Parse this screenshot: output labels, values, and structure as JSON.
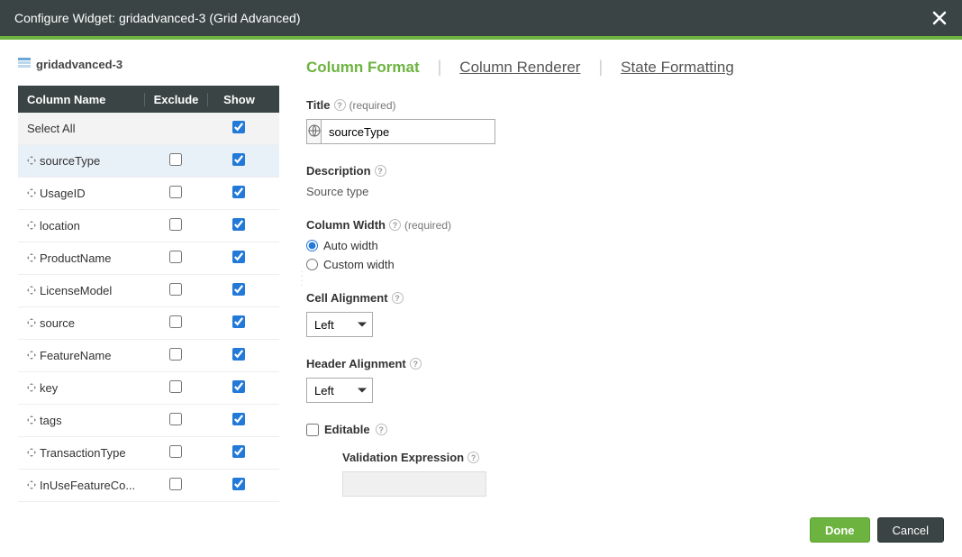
{
  "titlebar": "Configure Widget: gridadvanced-3 (Grid Advanced)",
  "widget_name": "gridadvanced-3",
  "cols_header": {
    "name": "Column Name",
    "exclude": "Exclude",
    "show": "Show"
  },
  "select_all_label": "Select All",
  "rows": [
    {
      "name": "sourceType",
      "exclude": false,
      "show": true,
      "selected": true
    },
    {
      "name": "UsageID",
      "exclude": false,
      "show": true
    },
    {
      "name": "location",
      "exclude": false,
      "show": true
    },
    {
      "name": "ProductName",
      "exclude": false,
      "show": true
    },
    {
      "name": "LicenseModel",
      "exclude": false,
      "show": true
    },
    {
      "name": "source",
      "exclude": false,
      "show": true
    },
    {
      "name": "FeatureName",
      "exclude": false,
      "show": true
    },
    {
      "name": "key",
      "exclude": false,
      "show": true
    },
    {
      "name": "tags",
      "exclude": false,
      "show": true
    },
    {
      "name": "TransactionType",
      "exclude": false,
      "show": true
    },
    {
      "name": "InUseFeatureCo...",
      "exclude": false,
      "show": true
    }
  ],
  "tabs": {
    "format": "Column Format",
    "renderer": "Column Renderer",
    "state": "State Formatting"
  },
  "form": {
    "title_label": "Title",
    "required": "(required)",
    "title_value": "sourceType",
    "desc_label": "Description",
    "desc_value": "Source type",
    "width_label": "Column Width",
    "width_auto": "Auto width",
    "width_custom": "Custom width",
    "cell_align_label": "Cell Alignment",
    "cell_align_value": "Left",
    "header_align_label": "Header Alignment",
    "header_align_value": "Left",
    "editable_label": "Editable",
    "validation_label": "Validation Expression"
  },
  "footer": {
    "done": "Done",
    "cancel": "Cancel"
  }
}
